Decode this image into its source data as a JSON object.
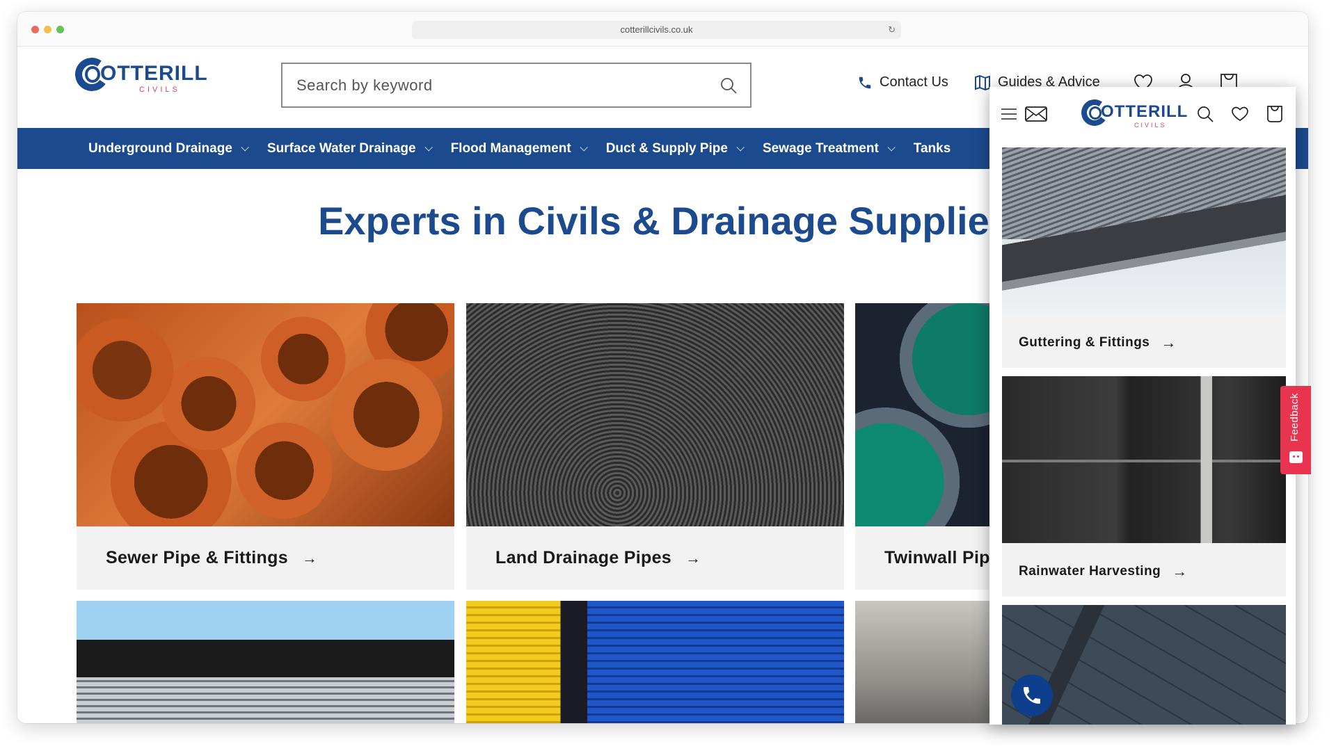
{
  "browser": {
    "url": "cotterillcivils.co.uk"
  },
  "header": {
    "logo_text": "OTTERILL",
    "logo_sub": "CIVILS",
    "search_placeholder": "Search by keyword",
    "contact_label": "Contact Us",
    "guides_label": "Guides & Advice"
  },
  "nav": {
    "items": [
      {
        "label": "Underground Drainage"
      },
      {
        "label": "Surface Water Drainage"
      },
      {
        "label": "Flood Management"
      },
      {
        "label": "Duct & Supply Pipe"
      },
      {
        "label": "Sewage Treatment"
      },
      {
        "label": "Tanks"
      }
    ]
  },
  "main": {
    "headline": "Experts in Civils & Drainage Supplies",
    "categories": [
      {
        "label": "Sewer Pipe & Fittings",
        "arrow": "→"
      },
      {
        "label": "Land Drainage Pipes",
        "arrow": "→"
      },
      {
        "label": "Twinwall Pipe",
        "arrow": "→"
      }
    ]
  },
  "mobile": {
    "logo_text": "OTTERILL",
    "logo_sub": "CIVILS",
    "categories": [
      {
        "label": "Guttering & Fittings",
        "arrow": "→"
      },
      {
        "label": "Rainwater Harvesting",
        "arrow": "→"
      }
    ]
  },
  "widgets": {
    "feedback_label": "Feedback"
  },
  "colors": {
    "brand_blue": "#1b4a8e",
    "brand_red": "#d0465f",
    "feedback_red": "#e8344e"
  }
}
